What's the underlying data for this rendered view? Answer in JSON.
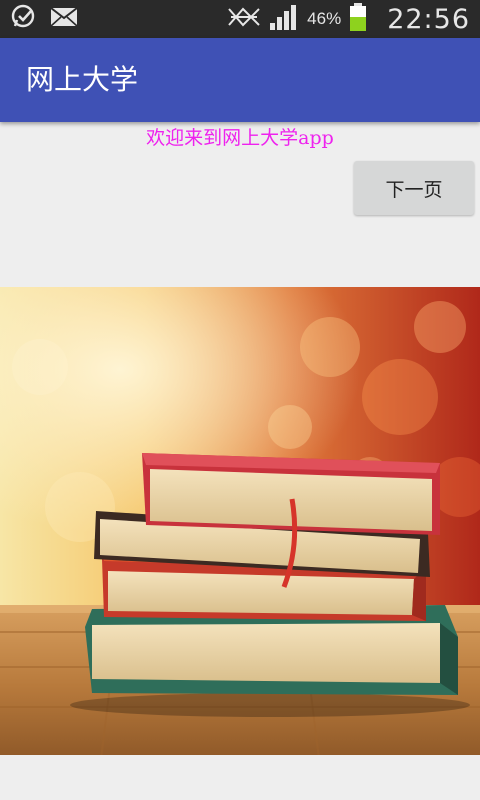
{
  "status_bar": {
    "battery_percent": "46%",
    "time": "22:56",
    "icons": [
      "whatsapp-icon",
      "mail-icon",
      "nfc-icon",
      "signal-icon",
      "battery-icon"
    ]
  },
  "app_bar": {
    "title": "网上大学",
    "color": "#3f51b5"
  },
  "main": {
    "welcome_text": "欢迎来到网上大学app",
    "welcome_color": "#ee22ee",
    "next_button_label": "下一页"
  },
  "hero_image": {
    "subject": "stack-of-books-photo"
  }
}
